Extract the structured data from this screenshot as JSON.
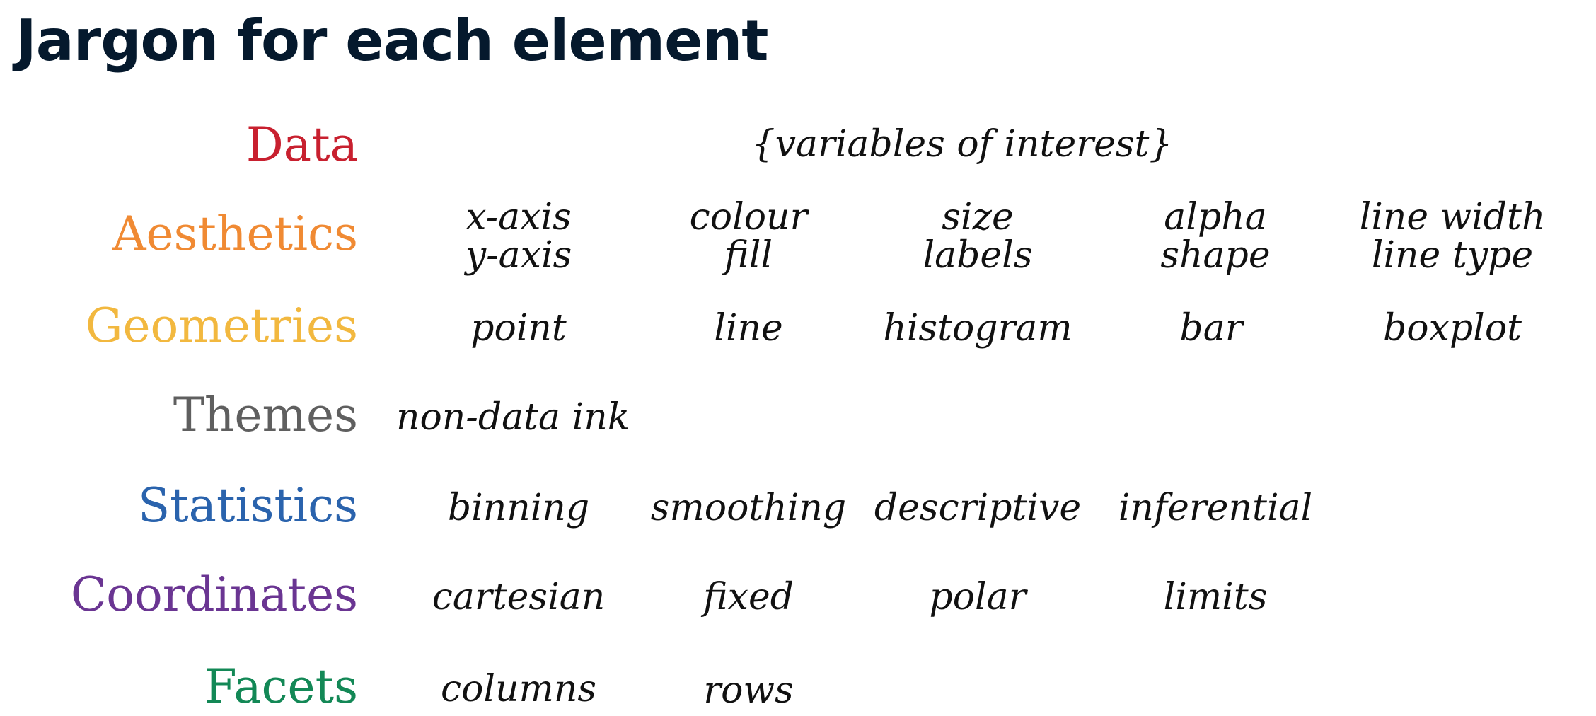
{
  "title": "Jargon for each element",
  "colors": {
    "title": "#05192d",
    "data": "#c8202f",
    "aesthetics": "#f08a33",
    "geometries": "#f2b83f",
    "themes": "#5f5f5f",
    "statistics": "#2a63ad",
    "coordinates": "#6a3592",
    "facets": "#138856"
  },
  "rows": {
    "data": {
      "label": "Data",
      "terms": [
        "{variables of interest}"
      ]
    },
    "aesthetics": {
      "label": "Aesthetics",
      "terms": [
        [
          "x-axis",
          "y-axis"
        ],
        [
          "colour",
          "fill"
        ],
        [
          "size",
          "labels"
        ],
        [
          "alpha",
          "shape"
        ],
        [
          "line width",
          "line type"
        ]
      ]
    },
    "geometries": {
      "label": "Geometries",
      "terms": [
        "point",
        "line",
        "histogram",
        "bar",
        "boxplot"
      ]
    },
    "themes": {
      "label": "Themes",
      "terms": [
        "non-data ink"
      ]
    },
    "statistics": {
      "label": "Statistics",
      "terms": [
        "binning",
        "smoothing",
        "descriptive",
        "inferential"
      ]
    },
    "coordinates": {
      "label": "Coordinates",
      "terms": [
        "cartesian",
        "fixed",
        "polar",
        "limits"
      ]
    },
    "facets": {
      "label": "Facets",
      "terms": [
        "columns",
        "rows"
      ]
    }
  }
}
